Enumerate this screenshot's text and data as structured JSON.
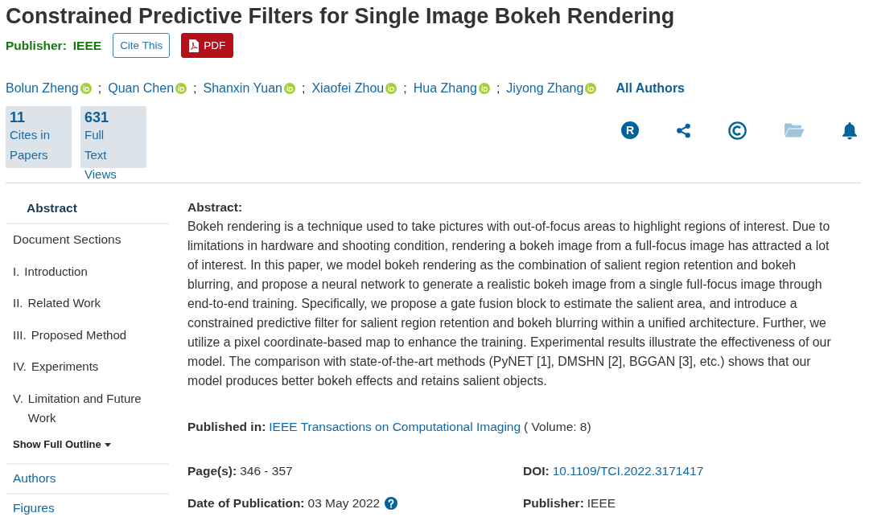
{
  "title": "Constrained Predictive Filters for Single Image Bokeh Rendering",
  "publisher": {
    "label": "Publisher:",
    "name": "IEEE"
  },
  "buttons": [
    {
      "kind": "outline",
      "label": "Cite This"
    },
    {
      "kind": "pdf",
      "label": "PDF"
    }
  ],
  "authors": [
    {
      "name": "Bolun Zheng",
      "separator": ";"
    },
    {
      "name": "Quan Chen",
      "separator": ";"
    },
    {
      "name": "Shanxin Yuan",
      "separator": ";"
    },
    {
      "name": "Xiaofei Zhou",
      "separator": ";"
    },
    {
      "name": "Hua Zhang",
      "separator": ";"
    },
    {
      "name": "Jiyong Zhang"
    }
  ],
  "all_authors": "All Authors",
  "metrics": [
    {
      "count": "11",
      "label": "Cites in Papers"
    },
    {
      "count": "631",
      "label": "Full Text Views"
    }
  ],
  "toolbar": [
    {
      "kind": "letter-disc",
      "glyph": "R",
      "disabled": false
    },
    {
      "kind": "share",
      "disabled": false
    },
    {
      "kind": "copyright",
      "disabled": false
    },
    {
      "kind": "folder",
      "disabled": true
    },
    {
      "kind": "bell",
      "disabled": false
    }
  ],
  "sidebar": {
    "items": [
      {
        "kind": "tab",
        "label": "Abstract",
        "selected": true
      },
      {
        "kind": "sections",
        "heading": "Document Sections",
        "children": [
          {
            "number": "I.",
            "title": "Introduction"
          },
          {
            "number": "II.",
            "title": "Related Work"
          },
          {
            "number": "III.",
            "title": "Proposed Method"
          },
          {
            "number": "IV.",
            "title": "Experiments"
          },
          {
            "number": "V.",
            "title": "Limitation and Future Work"
          }
        ]
      },
      {
        "kind": "toggle",
        "label": "Show Full Outline",
        "expanded": false
      },
      {
        "kind": "tab",
        "label": "Authors",
        "selected": false
      },
      {
        "kind": "tab",
        "label": "Figures",
        "selected": false
      }
    ]
  },
  "abstract": {
    "heading": "Abstract:",
    "text": "Bokeh rendering is a technique used to take pictures with out-of-focus areas to highlight regions of interest. Due to limitations in hardware and shooting condition, rendering a bokeh image from a full-focus image has attracted a lot of interest. In this paper, we model bokeh rendering as the combination of salient region retention and bokeh blurring, and propose a neural network to generate a realistic bokeh image from a single full-focus image through end-to-end training. Specifically, we propose a gate fusion block to estimate the salient area, and introduce a constrained predictive filter for salient region retention and bokeh blurring within a unified architecture. Further, we utilize a pixel coordinate-based map to enhance the training. Experimental results illustrate the effectiveness of our model. The comparison with state-of-the-art methods (PyNET [1], DMSHN [2], BGGAN [3], etc.) shows that our model produces better bokeh effects and retains salient objects."
  },
  "published_in": {
    "label": "Published in:",
    "journal": "IEEE Transactions on Computational Imaging",
    "volume": "( Volume: 8)"
  },
  "details": [
    {
      "kind": "text",
      "label": "Page(s):",
      "value": "346 - 357"
    },
    {
      "kind": "link",
      "label": "DOI:",
      "value": "10.1109/TCI.2022.3171417"
    },
    {
      "kind": "text-info",
      "label": "Date of Publication:",
      "value": "03 May 2022"
    },
    {
      "kind": "text",
      "label": "Publisher:",
      "value": "IEEE"
    }
  ]
}
